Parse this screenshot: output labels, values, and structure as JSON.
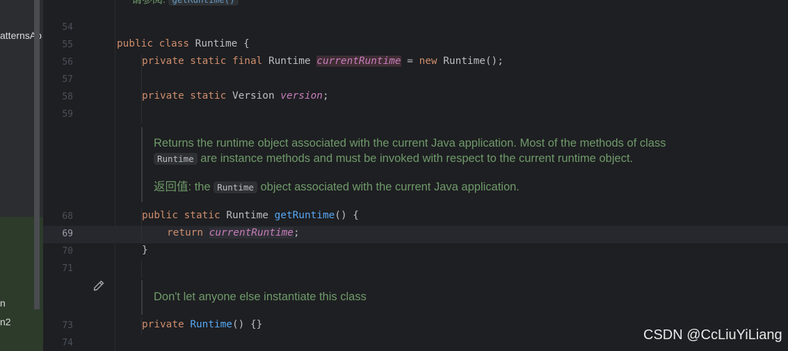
{
  "sidebar": {
    "items": [
      {
        "label": "atternsAp"
      },
      {
        "label": "n"
      },
      {
        "label": "n2"
      }
    ]
  },
  "top_snippet": {
    "prefix": "请参阅:",
    "link": "getRuntime()"
  },
  "lines": [
    {
      "n": "54"
    },
    {
      "n": "55",
      "t": [
        "public",
        "class",
        "Runtime {"
      ]
    },
    {
      "n": "56",
      "t": [
        "private static final",
        "Runtime",
        "currentRuntime",
        "= ",
        "new",
        "Runtime();"
      ]
    },
    {
      "n": "57"
    },
    {
      "n": "58",
      "t": [
        "private static",
        "Version",
        "version",
        ";"
      ]
    },
    {
      "n": "59"
    },
    {
      "n": "68",
      "t": [
        "public static",
        "Runtime",
        "getRuntime",
        "() {"
      ]
    },
    {
      "n": "69",
      "t": [
        "return",
        "currentRuntime",
        ";"
      ]
    },
    {
      "n": "70",
      "t": [
        "}"
      ]
    },
    {
      "n": "71"
    },
    {
      "n": "73",
      "t": [
        "private",
        "Runtime",
        "() {}"
      ]
    },
    {
      "n": "74"
    }
  ],
  "doc1": {
    "line1": "Returns the runtime object associated with the current Java application. Most of the methods of class",
    "pill": "Runtime",
    "line2": "are instance methods and must be invoked with respect to the current runtime object.",
    "return_label": "返回值:",
    "return_pre": "the",
    "return_pill": "Runtime",
    "return_post": "object associated with the current Java application."
  },
  "doc2": {
    "text": "Don't let anyone else instantiate this class"
  },
  "icons": {
    "edit": "pencil-icon"
  },
  "colors": {
    "keyword": "#cf8e6d",
    "field": "#c77dbb",
    "method": "#56a8f5",
    "doc_text": "#6f9a6a",
    "background": "#1e1f22"
  },
  "watermark": "CSDN @CcLiuYiLiang"
}
